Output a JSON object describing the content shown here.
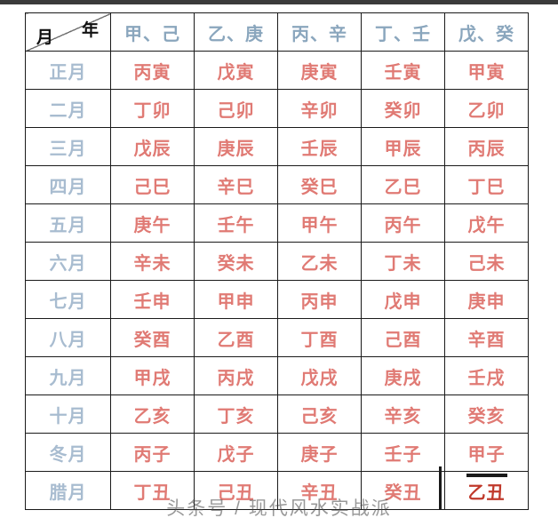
{
  "top_bar": {
    "present": true
  },
  "corner": {
    "year_label": "年",
    "month_label": "月"
  },
  "table": {
    "column_headers": [
      "甲、己",
      "乙、庚",
      "丙、辛",
      "丁、壬",
      "戊、癸"
    ],
    "row_headers": [
      "正月",
      "二月",
      "三月",
      "四月",
      "五月",
      "六月",
      "七月",
      "八月",
      "九月",
      "十月",
      "冬月",
      "腊月"
    ],
    "rows": [
      {
        "month": "正月",
        "cells": [
          "丙寅",
          "戊寅",
          "庚寅",
          "壬寅",
          "甲寅"
        ]
      },
      {
        "month": "二月",
        "cells": [
          "丁卯",
          "己卯",
          "辛卯",
          "癸卯",
          "乙卯"
        ]
      },
      {
        "month": "三月",
        "cells": [
          "戊辰",
          "庚辰",
          "壬辰",
          "甲辰",
          "丙辰"
        ]
      },
      {
        "month": "四月",
        "cells": [
          "己巳",
          "辛巳",
          "癸巳",
          "乙巳",
          "丁巳"
        ]
      },
      {
        "month": "五月",
        "cells": [
          "庚午",
          "壬午",
          "甲午",
          "丙午",
          "戊午"
        ]
      },
      {
        "month": "六月",
        "cells": [
          "辛未",
          "癸未",
          "乙未",
          "丁未",
          "己未"
        ]
      },
      {
        "month": "七月",
        "cells": [
          "壬申",
          "甲申",
          "丙申",
          "戊申",
          "庚申"
        ]
      },
      {
        "month": "八月",
        "cells": [
          "癸酉",
          "乙酉",
          "丁酉",
          "己酉",
          "辛酉"
        ]
      },
      {
        "month": "九月",
        "cells": [
          "甲戌",
          "丙戌",
          "戊戌",
          "庚戌",
          "壬戌"
        ]
      },
      {
        "month": "十月",
        "cells": [
          "乙亥",
          "丁亥",
          "己亥",
          "辛亥",
          "癸亥"
        ]
      },
      {
        "month": "冬月",
        "cells": [
          "丙子",
          "戊子",
          "庚子",
          "壬子",
          "甲子"
        ]
      },
      {
        "month": "腊月",
        "cells": [
          "丁丑",
          "己丑",
          "辛丑",
          "癸丑",
          "乙丑"
        ]
      }
    ],
    "emphasized_cell": {
      "row": 11,
      "col": 4,
      "value": "乙丑"
    }
  },
  "watermark": {
    "text": "头条号 / 现代风水实战派"
  },
  "colors": {
    "header_text": "#8aa6bd",
    "month_text": "#a8bcd0",
    "data_text": "#e07a74",
    "emphasis_text": "#c0392b",
    "border": "#1a1a1a",
    "corner_label": "#111111",
    "top_bar": "#3b3b3b"
  }
}
